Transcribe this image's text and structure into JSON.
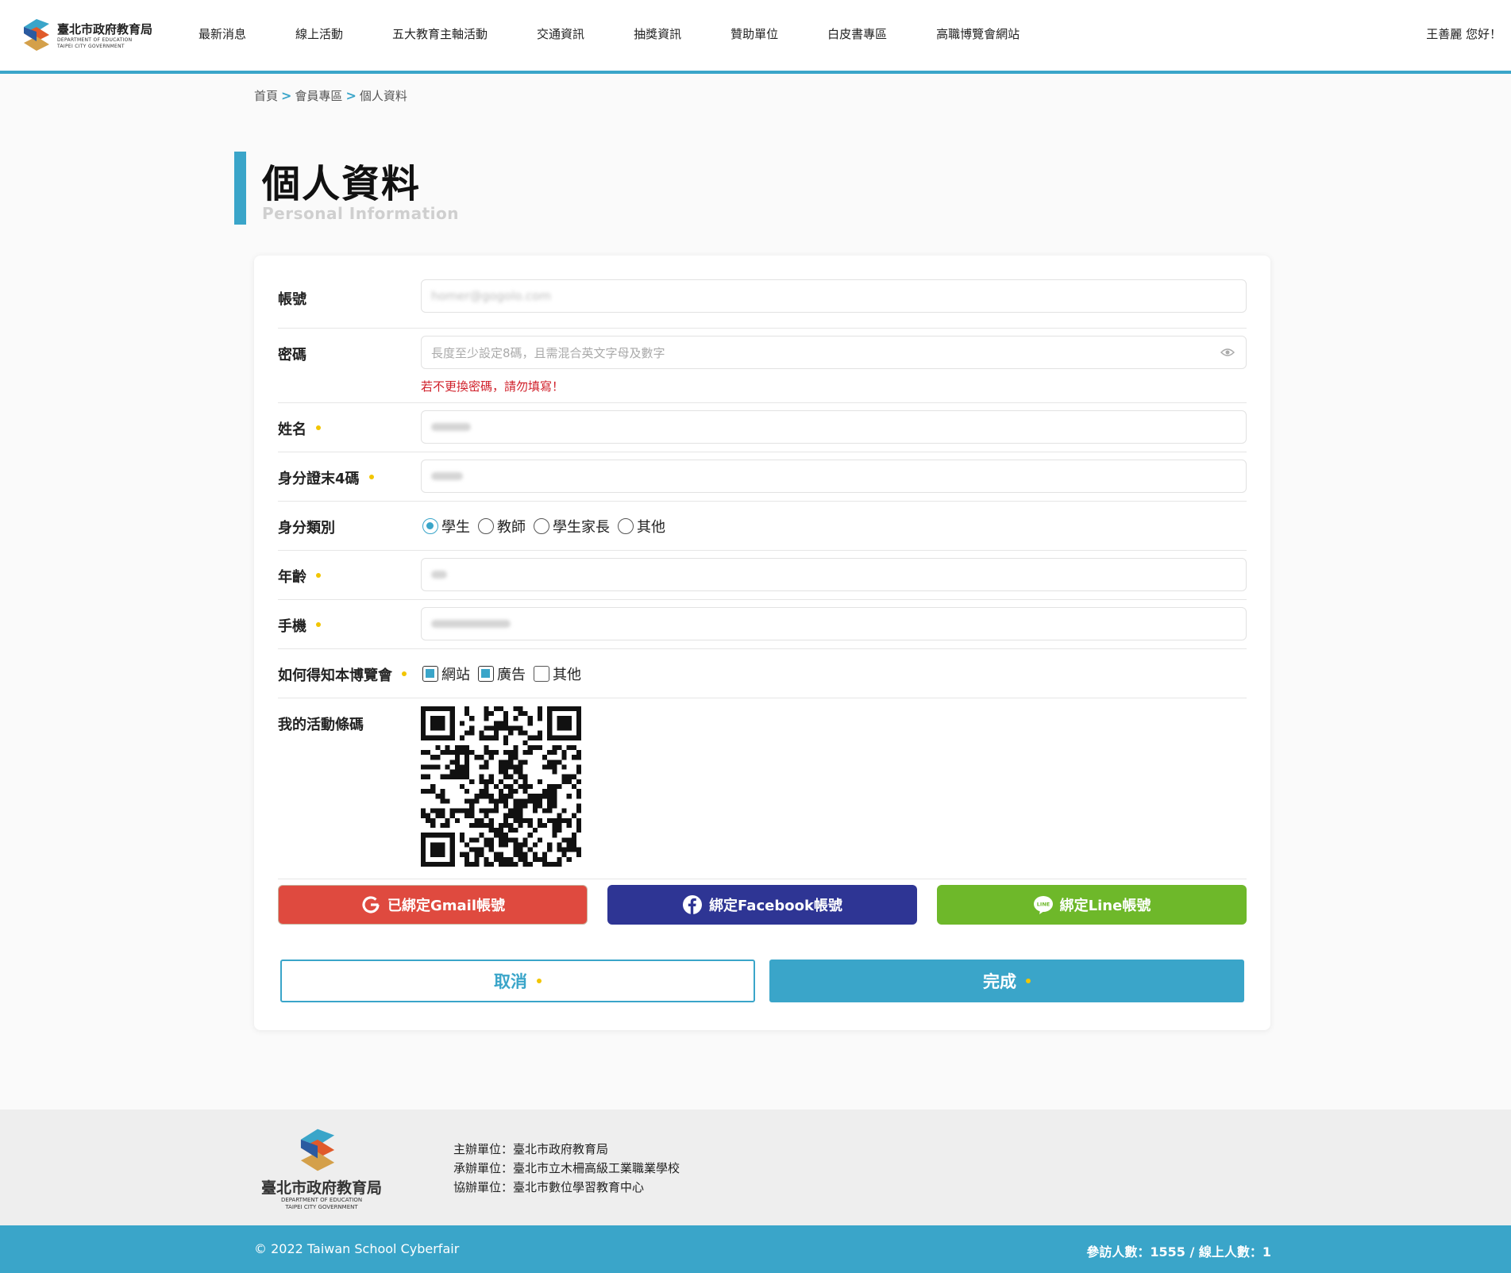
{
  "header": {
    "logo_text": "臺北市政府教育局",
    "logo_sub1": "DEPARTMENT OF EDUCATION",
    "logo_sub2": "TAIPEI CITY GOVERNMENT",
    "nav": [
      "最新消息",
      "線上活動",
      "五大教育主軸活動",
      "交通資訊",
      "抽獎資訊",
      "贊助單位",
      "白皮書專區",
      "高職博覽會網站"
    ],
    "greeting": "王善麗 您好！"
  },
  "breadcrumb": [
    "首頁",
    "會員專區",
    "個人資料"
  ],
  "page": {
    "title": "個人資料",
    "subtitle": "Personal Information"
  },
  "form": {
    "account": {
      "label": "帳號",
      "value": "homer@gogolo.com"
    },
    "password": {
      "label": "密碼",
      "placeholder": "長度至少設定8碼，且需混合英文字母及數字",
      "hint": "若不更換密碼，請勿填寫！"
    },
    "name": {
      "label": "姓名"
    },
    "id_last4": {
      "label": "身分證末4碼"
    },
    "identity": {
      "label": "身分類別",
      "options": [
        "學生",
        "教師",
        "學生家長",
        "其他"
      ],
      "selected": "學生"
    },
    "age": {
      "label": "年齡"
    },
    "mobile": {
      "label": "手機"
    },
    "source": {
      "label": "如何得知本博覽會",
      "options": [
        "網站",
        "廣告",
        "其他"
      ],
      "checked": [
        "網站",
        "廣告"
      ]
    },
    "barcode": {
      "label": "我的活動條碼"
    }
  },
  "bind": {
    "gmail": "已綁定Gmail帳號",
    "facebook": "綁定Facebook帳號",
    "line": "綁定Line帳號"
  },
  "actions": {
    "cancel": "取消",
    "done": "完成"
  },
  "footer": {
    "org": "臺北市政府教育局",
    "org_sub1": "DEPARTMENT OF EDUCATION",
    "org_sub2": "TAIPEI CITY GOVERNMENT",
    "host": "主辦單位：臺北市政府教育局",
    "organizer": "承辦單位：臺北市立木柵高級工業職業學校",
    "co_organizer": "協辦單位：臺北市數位學習教育中心",
    "copyright": "© 2022 Taiwan School Cyberfair",
    "stats": "參訪人數：1555 / 線上人數：1"
  },
  "colors": {
    "accent": "#3aa5c9",
    "gmail": "#df4a3f",
    "facebook": "#2e3594",
    "line": "#6eb82a",
    "required": "#f2c500",
    "warning": "#d0202a"
  }
}
